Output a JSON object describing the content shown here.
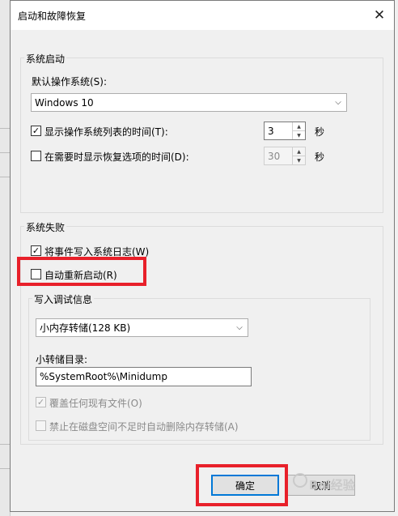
{
  "dialog": {
    "title": "启动和故障恢复",
    "close_glyph": "✕"
  },
  "system_startup": {
    "group_label": "系统启动",
    "default_os_label": "默认操作系统(S):",
    "default_os_value": "Windows 10",
    "show_os_list": {
      "label": "显示操作系统列表的时间(T):",
      "checked": true,
      "value": "3",
      "unit": "秒"
    },
    "show_recovery": {
      "label": "在需要时显示恢复选项的时间(D):",
      "checked": false,
      "value": "30",
      "unit": "秒"
    }
  },
  "system_failure": {
    "group_label": "系统失败",
    "write_event": {
      "label": "将事件写入系统日志(W)",
      "checked": true
    },
    "auto_restart": {
      "label": "自动重新启动(R)",
      "checked": false
    }
  },
  "debug_info": {
    "group_label": "写入调试信息",
    "dump_type": "小内存转储(128 KB)",
    "dump_dir_label": "小转储目录:",
    "dump_dir_value": "%SystemRoot%\\Minidump",
    "overwrite": {
      "label": "覆盖任何现有文件(O)",
      "checked": true
    },
    "disable_auto_delete": {
      "label": "禁止在磁盘空间不足时自动删除内存转储(A)",
      "checked": false
    }
  },
  "buttons": {
    "ok": "确定",
    "cancel": "取消"
  },
  "watermark": "Bai经验",
  "colors": {
    "highlight": "#e8202a",
    "focus": "#0078d7"
  }
}
